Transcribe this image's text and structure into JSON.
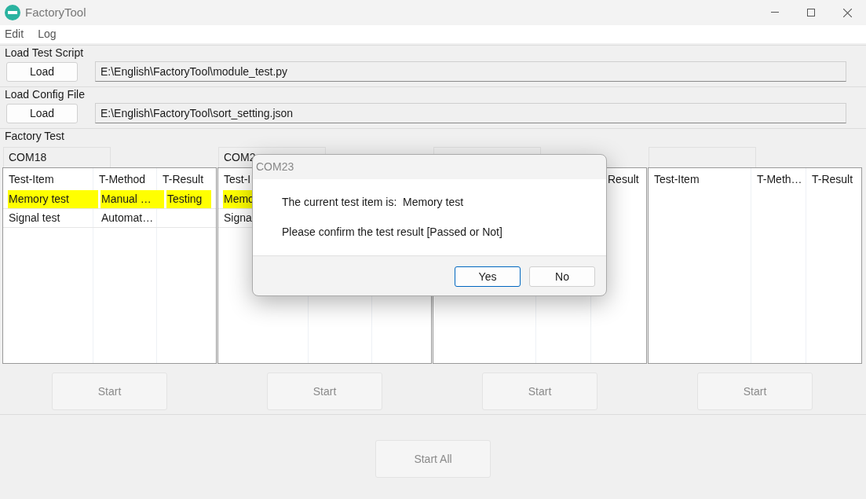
{
  "window": {
    "title": "FactoryTool"
  },
  "menu": [
    "Edit",
    "Log"
  ],
  "sections": [
    {
      "title": "Load Test Script",
      "button": "Load",
      "path": "E:\\English\\FactoryTool\\module_test.py"
    },
    {
      "title": "Load Config File",
      "button": "Load",
      "path": "E:\\English\\FactoryTool\\sort_setting.json"
    }
  ],
  "factory_test": {
    "title": "Factory Test",
    "panels": [
      {
        "title": "COM18",
        "columns": [
          "Test-Item",
          "T-Method",
          "T-Result"
        ],
        "rows": [
          {
            "cells": [
              "Memory test",
              "Manual …",
              "Testing"
            ],
            "highlighted": true
          },
          {
            "cells": [
              "Signal test",
              "Automat…",
              ""
            ],
            "highlighted": false
          }
        ],
        "button": {
          "label": "Start",
          "disabled": true
        }
      },
      {
        "title": "COM2",
        "columns": [
          "Test-I",
          "",
          ""
        ],
        "rows": [
          {
            "cells": [
              "Memo",
              "",
              ""
            ],
            "highlighted": true
          },
          {
            "cells": [
              "Signa",
              "",
              ""
            ],
            "highlighted": false
          }
        ],
        "button": {
          "label": "Start",
          "disabled": true
        }
      },
      {
        "columns": [
          "",
          "",
          "Result"
        ],
        "button": {
          "label": "Start",
          "disabled": true
        }
      },
      {
        "columns": [
          "Test-Item",
          "T-Meth…",
          "T-Result"
        ],
        "button": {
          "label": "Start",
          "disabled": true
        }
      }
    ],
    "start_all": {
      "label": "Start All",
      "disabled": true
    }
  },
  "dialog": {
    "title": "COM23",
    "lines": [
      "The current test item is:  Memory test",
      "Please confirm the test result [Passed or Not]"
    ],
    "buttons": [
      {
        "label": "Yes",
        "default": true
      },
      {
        "label": "No",
        "default": false
      }
    ]
  }
}
